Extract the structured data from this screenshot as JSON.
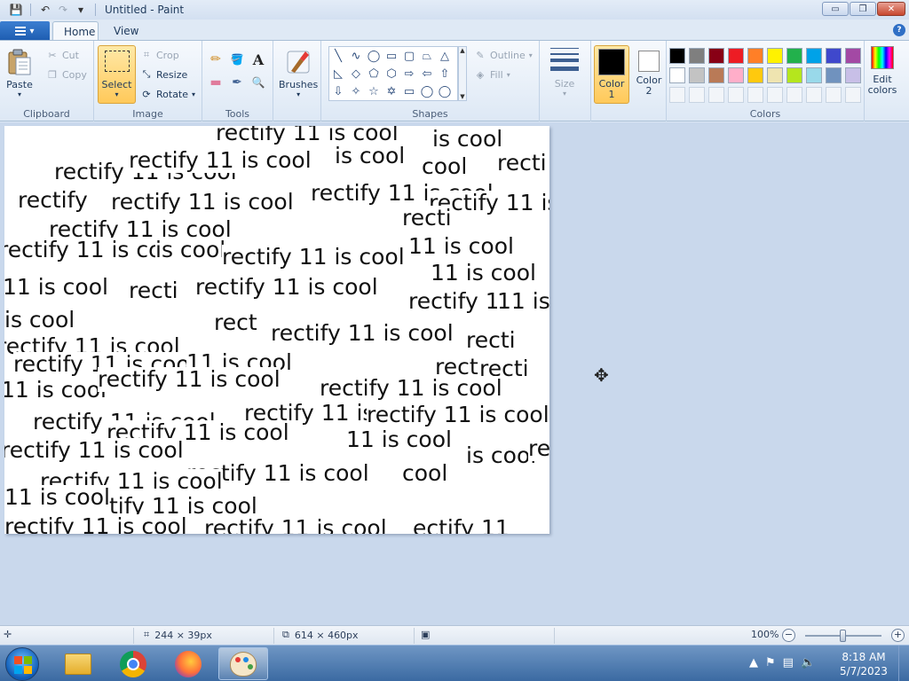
{
  "window": {
    "title": "Untitled - Paint",
    "minimize_glyph": "▭",
    "maximize_glyph": "❐",
    "close_glyph": "✕"
  },
  "quick_access": [
    {
      "name": "save-icon",
      "glyph": "💾"
    },
    {
      "name": "undo-icon",
      "glyph": "↶"
    },
    {
      "name": "redo-icon",
      "glyph": "↷"
    },
    {
      "name": "customize-qat-icon",
      "glyph": "▾"
    }
  ],
  "tabs": [
    {
      "label": "Home",
      "active": true
    },
    {
      "label": "View",
      "active": false
    }
  ],
  "help_glyph": "?",
  "ribbon": {
    "clipboard": {
      "label": "Clipboard",
      "paste": "Paste",
      "cut": "Cut",
      "copy": "Copy"
    },
    "image": {
      "label": "Image",
      "select": "Select",
      "crop": "Crop",
      "resize": "Resize",
      "rotate": "Rotate"
    },
    "tools": {
      "label": "Tools",
      "items": [
        {
          "name": "pencil-icon",
          "glyph": "✏"
        },
        {
          "name": "fill-icon",
          "glyph": "🪣"
        },
        {
          "name": "text-icon",
          "glyph": "A"
        },
        {
          "name": "eraser-icon",
          "glyph": "▬"
        },
        {
          "name": "color-picker-icon",
          "glyph": "✒"
        },
        {
          "name": "magnifier-icon",
          "glyph": "🔍"
        }
      ]
    },
    "brushes": {
      "label": "Brushes"
    },
    "shapes": {
      "label": "Shapes",
      "outline": "Outline",
      "fill": "Fill",
      "items": [
        "╲",
        "∿",
        "◯",
        "▭",
        "▢",
        "⏢",
        "△",
        "◺",
        "◇",
        "⬠",
        "⬡",
        "⇨",
        "⇦",
        "⇧",
        "⇩",
        "✧",
        "☆",
        "✡",
        "▭",
        "◯",
        "◯"
      ]
    },
    "size": {
      "label": "Size"
    },
    "color1": {
      "label": "Color 1",
      "value": "#000000"
    },
    "color2": {
      "label": "Color 2",
      "value": "#ffffff"
    },
    "colors": {
      "label": "Colors",
      "palette": [
        "#000000",
        "#7f7f7f",
        "#880015",
        "#ed1c24",
        "#ff7f27",
        "#fff200",
        "#22b14c",
        "#00a2e8",
        "#3f48cc",
        "#a349a4",
        "#ffffff",
        "#c3c3c3",
        "#b97a57",
        "#ffaec9",
        "#ffc90e",
        "#efe4b0",
        "#b5e61d",
        "#99d9ea",
        "#7092be",
        "#c8bfe7"
      ],
      "empty_count": 10
    },
    "edit_colors": "Edit colors"
  },
  "canvas": {
    "stamp_text_samples": [
      "rectify 11 is cool",
      "is cool",
      "recti",
      "rectify 11 is cool",
      "cool",
      "rectify",
      "rectify 11 is cool",
      "11 is cool",
      "rect",
      "tify 11 is cool",
      "ectify 11"
    ]
  },
  "status": {
    "selection_size": "244 × 39px",
    "canvas_size": "614 × 460px",
    "zoom": "100%",
    "zoom_fraction": 0.5
  },
  "taskbar": {
    "apps": [
      {
        "name": "taskbar-explorer",
        "icon": "folder-icon"
      },
      {
        "name": "taskbar-chrome",
        "icon": "chrome-icon"
      },
      {
        "name": "taskbar-firefox",
        "icon": "firefox-icon"
      },
      {
        "name": "taskbar-paint",
        "icon": "paint-icon"
      }
    ],
    "time": "8:18 AM",
    "date": "5/7/2023"
  }
}
